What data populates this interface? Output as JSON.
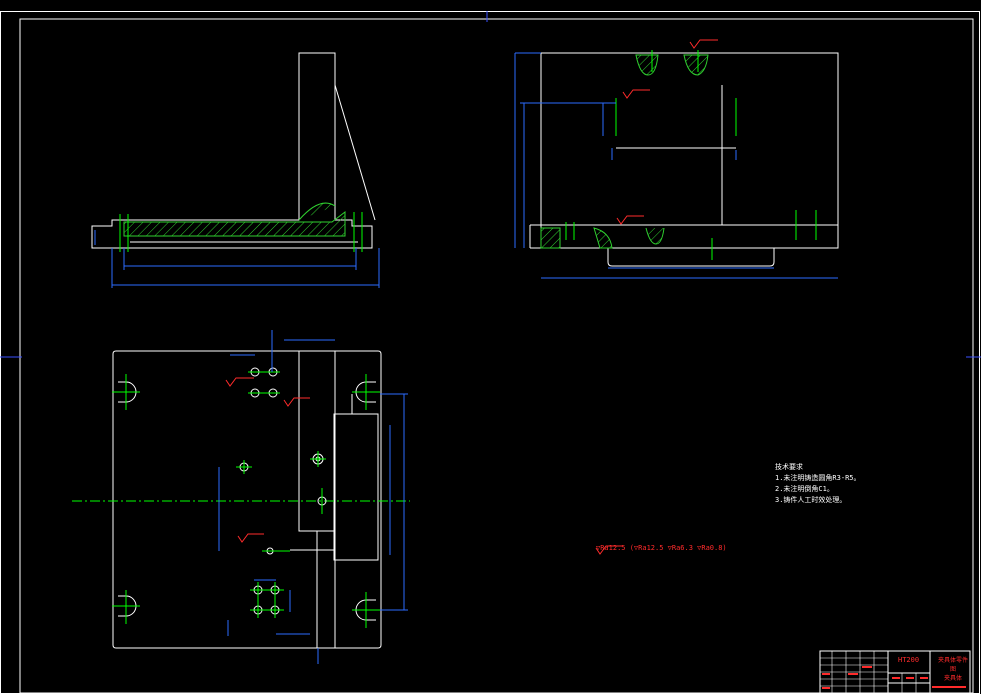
{
  "sheet": {
    "colors": {
      "background": "#000000",
      "outline": "#ffffff",
      "center_line": "#00ff00",
      "dimension": "#2c6cff",
      "annotation": "#ff2b2b",
      "hatch": "#2fd02f",
      "frame": "#3a50ff"
    }
  },
  "technical_requirements": {
    "heading": "技术要求",
    "items": [
      "1.未注明铸造圆角R3-R5。",
      "2.未注明倒角C1。",
      "3.铸件人工时效处理。"
    ]
  },
  "surface_finish_note": "▽Ra12.5 (▽Ra12.5 ▽Ra6.3 ▽Ra0.8)",
  "title_block": {
    "material": "HT200",
    "drawing_name_line1": "夹具体零件图",
    "drawing_name_line2": "夹具体"
  }
}
